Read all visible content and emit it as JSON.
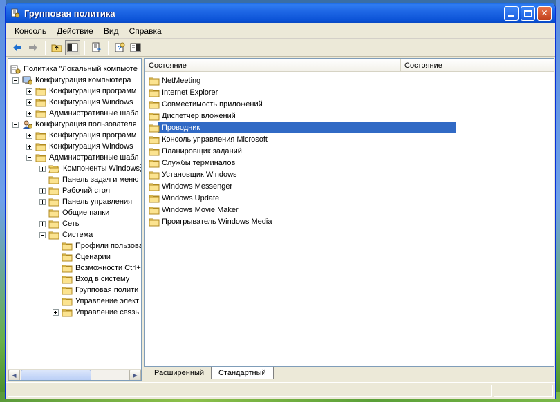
{
  "window": {
    "title": "Групповая политика"
  },
  "menu": [
    "Консоль",
    "Действие",
    "Вид",
    "Справка"
  ],
  "toolbar": {
    "buttons": [
      "back-icon",
      "forward-icon",
      "up-folder-icon",
      "show-hide-tree-icon",
      "export-list-icon",
      "help-icon",
      "properties-icon"
    ]
  },
  "tree": {
    "items": [
      {
        "label": "Политика \"Локальный компьюте",
        "icon": "policy-icon",
        "level": 0,
        "expander": "none"
      },
      {
        "label": "Конфигурация компьютера",
        "icon": "computer-icon",
        "level": 1,
        "expander": "minus"
      },
      {
        "label": "Конфигурация программ",
        "icon": "folder-icon",
        "level": 2,
        "expander": "plus"
      },
      {
        "label": "Конфигурация Windows",
        "icon": "folder-icon",
        "level": 2,
        "expander": "plus"
      },
      {
        "label": "Административные шабл",
        "icon": "folder-icon",
        "level": 2,
        "expander": "plus"
      },
      {
        "label": "Конфигурация пользователя",
        "icon": "user-icon",
        "level": 1,
        "expander": "minus"
      },
      {
        "label": "Конфигурация программ",
        "icon": "folder-icon",
        "level": 2,
        "expander": "plus"
      },
      {
        "label": "Конфигурация Windows",
        "icon": "folder-icon",
        "level": 2,
        "expander": "plus"
      },
      {
        "label": "Административные шабл",
        "icon": "folder-icon",
        "level": 2,
        "expander": "minus"
      },
      {
        "label": "Компоненты Windows",
        "icon": "folder-open-icon",
        "level": 3,
        "expander": "plus",
        "selected": true
      },
      {
        "label": "Панель задач и меню",
        "icon": "folder-icon",
        "level": 3,
        "expander": "none"
      },
      {
        "label": "Рабочий стол",
        "icon": "folder-icon",
        "level": 3,
        "expander": "plus"
      },
      {
        "label": "Панель управления",
        "icon": "folder-icon",
        "level": 3,
        "expander": "plus"
      },
      {
        "label": "Общие папки",
        "icon": "folder-icon",
        "level": 3,
        "expander": "none"
      },
      {
        "label": "Сеть",
        "icon": "folder-icon",
        "level": 3,
        "expander": "plus"
      },
      {
        "label": "Система",
        "icon": "folder-icon",
        "level": 3,
        "expander": "minus"
      },
      {
        "label": "Профили пользова",
        "icon": "folder-icon",
        "level": 4,
        "expander": "none"
      },
      {
        "label": "Сценарии",
        "icon": "folder-icon",
        "level": 4,
        "expander": "none"
      },
      {
        "label": "Возможности Ctrl+",
        "icon": "folder-icon",
        "level": 4,
        "expander": "none"
      },
      {
        "label": "Вход в систему",
        "icon": "folder-icon",
        "level": 4,
        "expander": "none"
      },
      {
        "label": "Групповая полити",
        "icon": "folder-icon",
        "level": 4,
        "expander": "none"
      },
      {
        "label": "Управление элект",
        "icon": "folder-icon",
        "level": 4,
        "expander": "none"
      },
      {
        "label": "Управление связь",
        "icon": "folder-icon",
        "level": 4,
        "expander": "plus"
      }
    ]
  },
  "list": {
    "columns": [
      "Состояние",
      "Состояние"
    ],
    "items": [
      {
        "label": "NetMeeting"
      },
      {
        "label": "Internet Explorer"
      },
      {
        "label": "Совместимость приложений"
      },
      {
        "label": "Диспетчер вложений"
      },
      {
        "label": "Проводник",
        "selected": true
      },
      {
        "label": "Консоль управления Microsoft"
      },
      {
        "label": "Планировщик заданий"
      },
      {
        "label": "Службы терминалов"
      },
      {
        "label": "Установщик Windows"
      },
      {
        "label": "Windows Messenger"
      },
      {
        "label": "Windows Update"
      },
      {
        "label": "Windows Movie Maker"
      },
      {
        "label": "Проигрыватель Windows Media"
      }
    ]
  },
  "tabs": [
    {
      "label": "Расширенный",
      "active": false
    },
    {
      "label": "Стандартный",
      "active": true
    }
  ],
  "colors": {
    "titlebar": "#0b52d6",
    "selection": "#316ac5",
    "folder": "#f5d76e"
  }
}
